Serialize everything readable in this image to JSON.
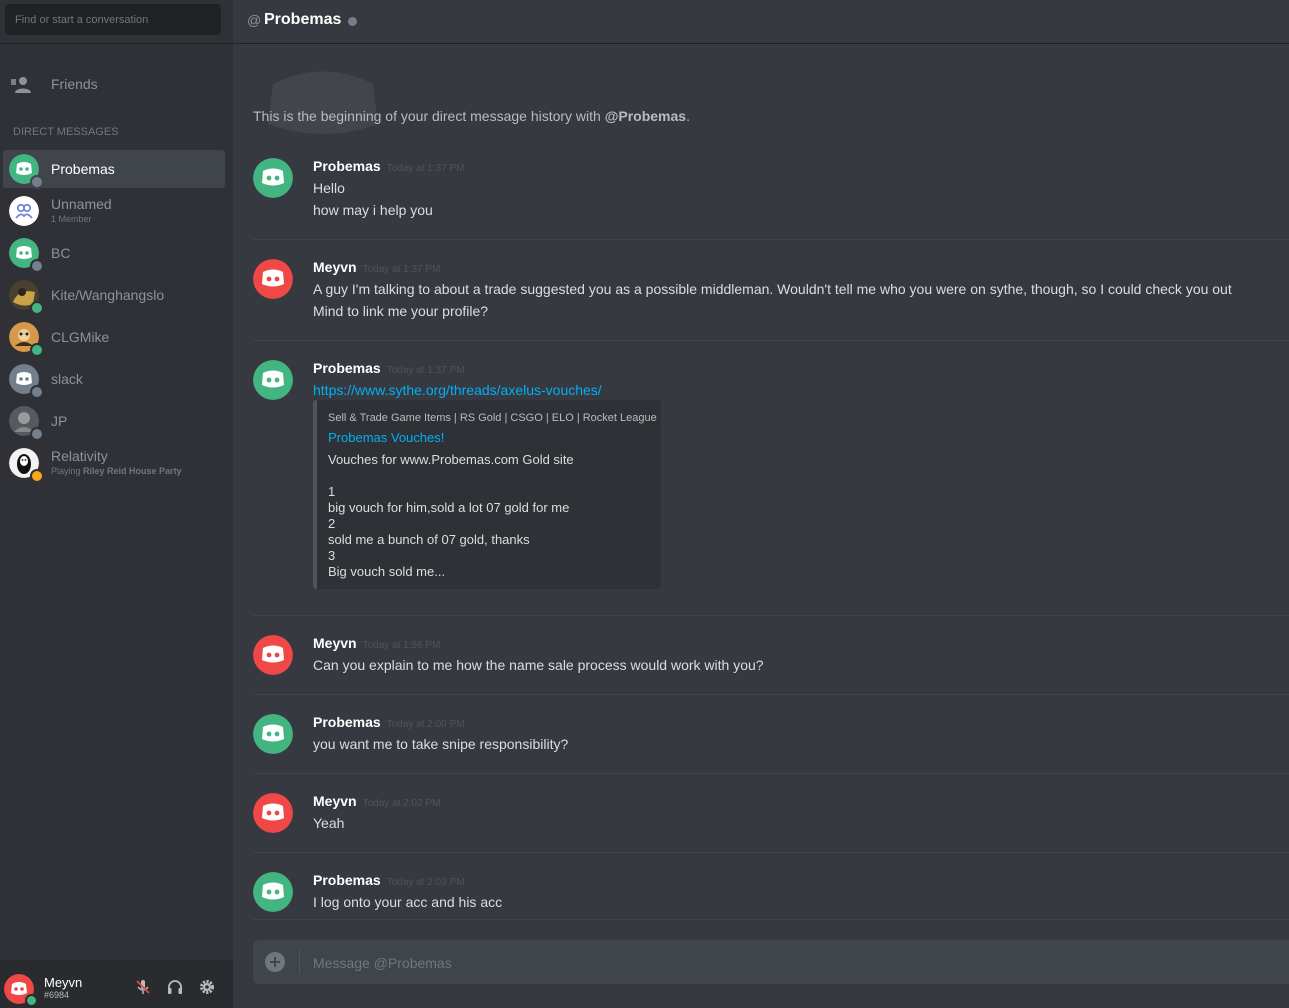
{
  "search": {
    "placeholder": "Find or start a conversation"
  },
  "friends": {
    "label": "Friends"
  },
  "dm_header": "Direct Messages",
  "dms": [
    {
      "name": "Probemas",
      "sub": "",
      "avatar_color": "#43b581",
      "status_color": "#747f8d",
      "active": true
    },
    {
      "name": "Unnamed",
      "sub": "1 Member",
      "avatar_color": "#ffffff",
      "status_color": "",
      "active": false
    },
    {
      "name": "BC",
      "sub": "",
      "avatar_color": "#43b581",
      "status_color": "#747f8d",
      "active": false
    },
    {
      "name": "Kite/Wanghangslo",
      "sub": "",
      "avatar_color": "#6b5a3a",
      "status_color": "#43b581",
      "active": false
    },
    {
      "name": "CLGMike",
      "sub": "",
      "avatar_color": "#a0703a",
      "status_color": "#43b581",
      "active": false
    },
    {
      "name": "slack",
      "sub": "",
      "avatar_color": "#747f8d",
      "status_color": "#747f8d",
      "active": false
    },
    {
      "name": "JP",
      "sub": "",
      "avatar_color": "#555a60",
      "status_color": "#747f8d",
      "active": false
    },
    {
      "name": "Relativity",
      "sub_prefix": "Playing ",
      "sub_game": "Riley Reid House Party",
      "avatar_color": "#f2f2f2",
      "status_color": "#faa61a",
      "active": false
    }
  ],
  "user": {
    "name": "Meyvn",
    "tag": "#6984"
  },
  "channel": {
    "at": "@",
    "title": "Probemas"
  },
  "beginning": {
    "prefix": "This is the beginning of your direct message history with ",
    "mention": "@Probemas",
    "suffix": "."
  },
  "messages": [
    {
      "author": "Probemas",
      "time": "Today at 1:37 PM",
      "color": "#43b581",
      "lines": [
        "Hello",
        "how may i help you"
      ]
    },
    {
      "author": "Meyvn",
      "time": "Today at 1:37 PM",
      "color": "#f04747",
      "lines": [
        "A guy I'm talking to about a trade suggested you as a possible middleman. Wouldn't tell me who you were on sythe, though, so I could check you out",
        "Mind to link me your profile?"
      ]
    },
    {
      "author": "Probemas",
      "time": "Today at 1:37 PM",
      "color": "#43b581",
      "link": "https://www.sythe.org/threads/axelus-vouches/"
    },
    {
      "author": "Meyvn",
      "time": "Today at 1:56 PM",
      "color": "#f04747",
      "lines": [
        "Can you explain to me how the name sale process would work with you?"
      ]
    },
    {
      "author": "Probemas",
      "time": "Today at 2:00 PM",
      "color": "#43b581",
      "lines": [
        "you want me to take snipe responsibility?"
      ]
    },
    {
      "author": "Meyvn",
      "time": "Today at 2:02 PM",
      "color": "#f04747",
      "lines": [
        "Yeah"
      ]
    },
    {
      "author": "Probemas",
      "time": "Today at 2:03 PM",
      "color": "#43b581",
      "lines": [
        "I log onto your acc and his acc"
      ]
    }
  ],
  "embed": {
    "provider": "Sell & Trade Game Items | RS Gold | CSGO | ELO | Rocket League",
    "title": "Probemas Vouches!",
    "lines": [
      "Vouches for www.Probemas.com Gold site",
      "",
      "1",
      "big vouch for him,sold a lot 07 gold for me",
      "2",
      "sold me a bunch of 07 gold, thanks",
      "3",
      "Big vouch sold me..."
    ]
  },
  "composer": {
    "placeholder": "Message @Probemas"
  },
  "colors": {
    "green": "#43b581",
    "red": "#f04747",
    "link": "#00b0f4",
    "background": "#36393f",
    "sidebar": "#2f3136"
  }
}
